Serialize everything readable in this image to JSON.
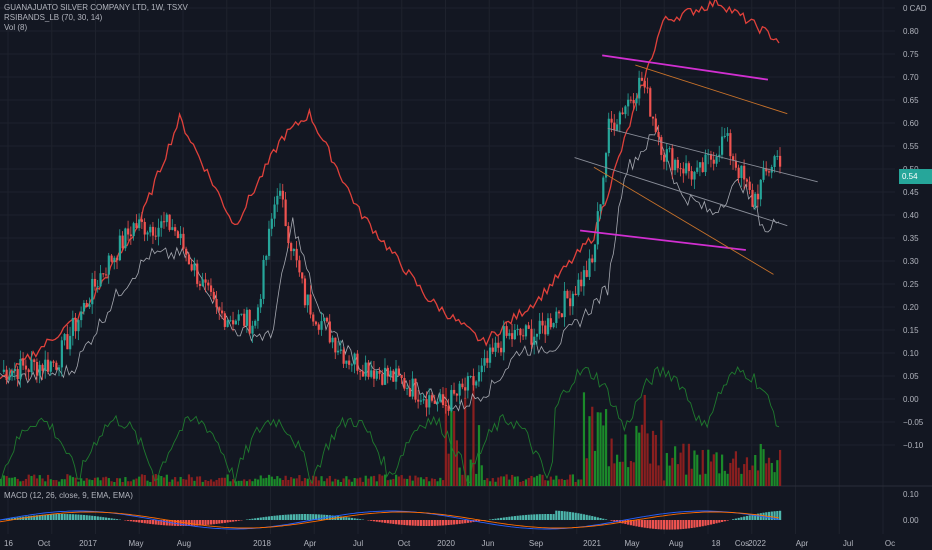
{
  "legend": {
    "symbol": "GUANAJUATO SILVER COMPANY LTD, 1W, TSXV",
    "rsi": "RSIBANDS_LB (70, 30, 14)",
    "vol": "Vol (8)"
  },
  "macd_legend": "MACD (12, 26, close, 9, EMA, EMA)",
  "price_tag": "0.54",
  "colors": {
    "background": "#131722",
    "up": "#26a69a",
    "down": "#ef5350",
    "rsi_line": "#e0413b",
    "white_line": "#c9ccd3",
    "green_line": "#1f7a2e",
    "magenta": "#d12fd1",
    "orange": "#c8722a",
    "trend_gray": "#8a8e99",
    "vol_up": "#1b8a2a",
    "vol_down": "#8a1f1f"
  },
  "chart_data": {
    "type": "candlestick",
    "y_axis_ticks": [
      "0 CAD",
      "0.80",
      "0.75",
      "0.70",
      "0.65",
      "0.60",
      "0.55",
      "0.50",
      "0.45",
      "0.40",
      "0.35",
      "0.30",
      "0.25",
      "0.20",
      "0.15",
      "0.10",
      "0.05",
      "0.00",
      "−0.05",
      "−0.10"
    ],
    "macd_axis_ticks": [
      "0.10",
      "0.00"
    ],
    "x_axis_ticks": [
      "16",
      "Oct",
      "2017",
      "May",
      "Aug",
      "2018",
      "Apr",
      "Jul",
      "Oct",
      "2020",
      "Jun",
      "Sep",
      "2021",
      "May",
      "Aug",
      "18",
      "Cos",
      "2022",
      "Apr",
      "Jul",
      "Oc"
    ],
    "price_anchors": [
      {
        "week": 0,
        "price": 0.1
      },
      {
        "week": 20,
        "price": 0.12
      },
      {
        "week": 36,
        "price": 0.3
      },
      {
        "week": 48,
        "price": 0.4
      },
      {
        "week": 62,
        "price": 0.4
      },
      {
        "week": 78,
        "price": 0.22
      },
      {
        "week": 92,
        "price": 0.2
      },
      {
        "week": 100,
        "price": 0.48
      },
      {
        "week": 110,
        "price": 0.25
      },
      {
        "week": 125,
        "price": 0.13
      },
      {
        "week": 145,
        "price": 0.08
      },
      {
        "week": 160,
        "price": 0.03
      },
      {
        "week": 172,
        "price": 0.08
      },
      {
        "week": 182,
        "price": 0.17
      },
      {
        "week": 195,
        "price": 0.18
      },
      {
        "week": 205,
        "price": 0.25
      },
      {
        "week": 214,
        "price": 0.32
      },
      {
        "week": 220,
        "price": 0.6
      },
      {
        "week": 232,
        "price": 0.7
      },
      {
        "week": 240,
        "price": 0.55
      },
      {
        "week": 252,
        "price": 0.5
      },
      {
        "week": 262,
        "price": 0.58
      },
      {
        "week": 272,
        "price": 0.45
      },
      {
        "week": 280,
        "price": 0.54
      }
    ],
    "rsi_anchors": [
      {
        "week": 0,
        "value": 0.08
      },
      {
        "week": 30,
        "value": 0.22
      },
      {
        "week": 50,
        "value": 0.4
      },
      {
        "week": 65,
        "value": 0.62
      },
      {
        "week": 85,
        "value": 0.4
      },
      {
        "week": 102,
        "value": 0.58
      },
      {
        "week": 112,
        "value": 0.63
      },
      {
        "week": 130,
        "value": 0.43
      },
      {
        "week": 155,
        "value": 0.25
      },
      {
        "week": 175,
        "value": 0.16
      },
      {
        "week": 195,
        "value": 0.25
      },
      {
        "week": 215,
        "value": 0.38
      },
      {
        "week": 240,
        "value": 0.82
      },
      {
        "week": 260,
        "value": 0.86
      },
      {
        "week": 282,
        "value": 0.78
      }
    ],
    "trend_lines": [
      {
        "from": [
          218,
          0.75
        ],
        "to": [
          278,
          0.7
        ],
        "color": "magenta"
      },
      {
        "from": [
          210,
          0.39
        ],
        "to": [
          270,
          0.35
        ],
        "color": "magenta"
      },
      {
        "from": [
          230,
          0.73
        ],
        "to": [
          285,
          0.63
        ],
        "color": "orange"
      },
      {
        "from": [
          215,
          0.52
        ],
        "to": [
          280,
          0.3
        ],
        "color": "orange"
      },
      {
        "from": [
          220,
          0.6
        ],
        "to": [
          296,
          0.49
        ],
        "color": "trend_gray"
      },
      {
        "from": [
          208,
          0.54
        ],
        "to": [
          285,
          0.4
        ],
        "color": "trend_gray"
      }
    ]
  }
}
